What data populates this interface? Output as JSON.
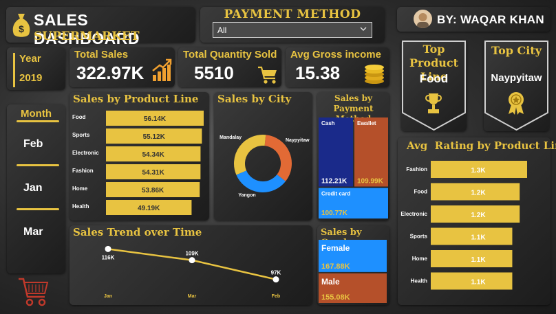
{
  "header": {
    "title": "SALES DASHBOARD",
    "subtitle": "SUPERMARKET",
    "payment_method_label": "Payment Method",
    "payment_method_value": "All",
    "author": "BY: WAQAR KHAN"
  },
  "filters": {
    "year_label": "Year",
    "year_value": "2019",
    "month_label": "Month",
    "months": [
      "Feb",
      "Jan",
      "Mar"
    ]
  },
  "kpis": {
    "total_sales_label": "Total Sales",
    "total_sales_value": "322.97K",
    "total_qty_label": "Total Quantity Sold",
    "total_qty_value": "5510",
    "avg_gross_label": "Avg Gross income",
    "avg_gross_value": "15.38"
  },
  "top_cards": {
    "product_line_label": "Top Product Line",
    "product_line_value": "Food",
    "city_label": "Top City",
    "city_value": "Naypyitaw"
  },
  "colors": {
    "gold": "#e8c341",
    "navy": "#1a2a8a",
    "rust": "#b5502a",
    "blue": "#1e90ff",
    "orange": "#e26a35"
  },
  "icons": [
    "money-bag-icon",
    "growth-chart-icon",
    "shopping-cart-icon",
    "coins-icon",
    "trophy-icon",
    "medal-icon",
    "chevron-down-icon"
  ],
  "chart_data": [
    {
      "type": "bar",
      "title": "Sales by Product Line",
      "categories": [
        "Food",
        "Sports",
        "Electronic",
        "Fashion",
        "Home",
        "Health"
      ],
      "values": [
        56.14,
        55.12,
        54.34,
        54.31,
        53.86,
        49.19
      ],
      "labels": [
        "56.14K",
        "55.12K",
        "54.34K",
        "54.31K",
        "53.86K",
        "49.19K"
      ]
    },
    {
      "type": "pie",
      "title": "Sales by City",
      "slices": [
        {
          "name": "Naypyitaw",
          "value": 34,
          "color": "#e26a35"
        },
        {
          "name": "Yangon",
          "value": 33,
          "color": "#1e90ff"
        },
        {
          "name": "Mandalay",
          "value": 33,
          "color": "#e8c341"
        }
      ]
    },
    {
      "type": "heatmap",
      "title": "Sales by Payment Method",
      "cells": [
        {
          "name": "Cash",
          "value": 112.21,
          "label": "112.21K",
          "color": "#1a2a8a"
        },
        {
          "name": "Ewallet",
          "value": 109.99,
          "label": "109.99K",
          "color": "#b5502a"
        },
        {
          "name": "Credit card",
          "value": 100.77,
          "label": "100.77K",
          "color": "#1e90ff"
        }
      ]
    },
    {
      "type": "line",
      "title": "Sales Trend over Time",
      "categories": [
        "Jan",
        "Mar",
        "Feb"
      ],
      "values": [
        116,
        109,
        97
      ],
      "labels": [
        "116K",
        "109K",
        "97K"
      ]
    },
    {
      "type": "heatmap",
      "title": "Sales by Gender",
      "cells": [
        {
          "name": "Female",
          "value": 167.88,
          "label": "167.88K",
          "color": "#1e90ff"
        },
        {
          "name": "Male",
          "value": 155.08,
          "label": "155.08K",
          "color": "#b5502a"
        }
      ]
    },
    {
      "type": "bar",
      "title": "Avg  Rating by Product Line",
      "categories": [
        "Fashion",
        "Food",
        "Electronic",
        "Sports",
        "Home",
        "Health"
      ],
      "values": [
        1.3,
        1.2,
        1.2,
        1.1,
        1.1,
        1.1
      ],
      "labels": [
        "1.3K",
        "1.2K",
        "1.2K",
        "1.1K",
        "1.1K",
        "1.1K"
      ]
    }
  ]
}
